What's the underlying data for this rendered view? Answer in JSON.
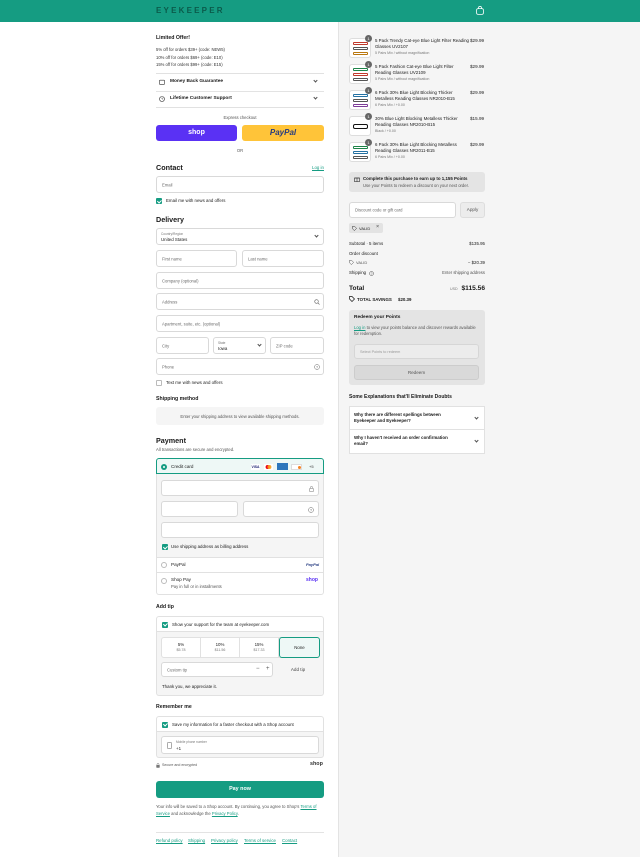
{
  "header": {
    "logo": "EYEKEEPER"
  },
  "offer": {
    "title": "Limited Offer!",
    "lines": [
      "5% off for orders $39+ (code: NEW5)",
      "10% off for orders $69+ (code: E10)",
      "15% off for orders $99+ (code: E15)"
    ],
    "money_back": "Money Back Guarantee",
    "support": "Lifetime Customer Support"
  },
  "express": {
    "label": "Express checkout",
    "shop": "shop",
    "paypal": "PayPal",
    "or": "OR"
  },
  "contact": {
    "title": "Contact",
    "login": "Log in",
    "email_placeholder": "Email",
    "news_label": "Email me with news and offers"
  },
  "delivery": {
    "title": "Delivery",
    "country_label": "Country/Region",
    "country_value": "United States",
    "first_name": "First name",
    "last_name": "Last name",
    "company": "Company (optional)",
    "address": "Address",
    "apartment": "Apartment, suite, etc. (optional)",
    "city": "City",
    "state_label": "State",
    "state_value": "Iowa",
    "zip": "ZIP code",
    "phone": "Phone",
    "text_news": "Text me with news and offers"
  },
  "shipping": {
    "title": "Shipping method",
    "message": "Enter your shipping address to view available shipping methods."
  },
  "payment": {
    "title": "Payment",
    "subtitle": "All transactions are secure and encrypted.",
    "credit_card": "Credit card",
    "card_more": "+5",
    "billing_same": "Use shipping address as billing address",
    "paypal": "PayPal",
    "paypal_logo": "PayPal",
    "shop_pay": "Shop Pay",
    "shop_pay_sub": "Pay in full or in installments",
    "shop_logo": "shop"
  },
  "tip": {
    "title": "Add tip",
    "show_support": "Show your support for the team at eyekeeper.com",
    "options": [
      {
        "pct": "5%",
        "amt": "$5.78"
      },
      {
        "pct": "10%",
        "amt": "$11.56"
      },
      {
        "pct": "15%",
        "amt": "$17.33"
      },
      {
        "pct": "None",
        "amt": ""
      }
    ],
    "custom_placeholder": "Custom tip",
    "add_button": "Add tip",
    "thanks": "Thank you, we appreciate it."
  },
  "remember": {
    "title": "Remember me",
    "save_label": "Save my information for a faster checkout with a Shop account",
    "phone_label": "Mobile phone number",
    "phone_value": "+1",
    "secure": "Secure and encrypted",
    "shop_logo": "shop"
  },
  "pay_button": "Pay now",
  "legal": {
    "text1": "Your info will be saved to a Shop account. By continuing, you agree to Shop's",
    "terms": "Terms of Service",
    "text2": "and acknowledge the",
    "privacy": "Privacy Policy",
    "text3": "."
  },
  "footer": {
    "links": [
      "Refund policy",
      "Shipping",
      "Privacy policy",
      "Terms of service",
      "Contact"
    ]
  },
  "order": {
    "items": [
      {
        "qty": "1",
        "name": "5 Pack Trendy Cat-eye Blue Light Filter Reading Glasses UV2107",
        "sub": "5 Pairs Mix / without magnification",
        "price": "$29.99"
      },
      {
        "qty": "1",
        "name": "5 Pack Fashion Cat-eye Blue Light Filter Reading Glasses UV2109",
        "sub": "5 Pairs Mix / without magnification",
        "price": "$29.99"
      },
      {
        "qty": "1",
        "name": "6 Pack 30% Blue Light Blocking Thicker Metalless Reading Glasses NR2010-B15",
        "sub": "6 Pairs Mix / +0.00",
        "price": "$29.99"
      },
      {
        "qty": "1",
        "name": "30% Blue Light Blocking Metalless Thicker Reading Glasses NR2010-B15",
        "sub": "Black / +0.00",
        "price": "$15.99"
      },
      {
        "qty": "1",
        "name": "6 Pack 30% Blue Light Blocking Metalless Reading Glasses NR2011-B15",
        "sub": "6 Pairs Mix / +0.00",
        "price": "$29.99"
      }
    ],
    "points_title": "Complete this purchase to earn up to 1,155 Points",
    "points_sub": "Use your Points to redeem a discount on your next order.",
    "discount_placeholder": "Discount code or gift card",
    "apply": "Apply",
    "tag": "VALID",
    "subtotal_label": "Subtotal · 5 items",
    "subtotal": "$135.95",
    "order_discount": "Order discount",
    "discount_code": "VALID",
    "discount_amount": "− $20.39",
    "shipping_label": "Shipping",
    "shipping_value": "Enter shipping address",
    "total_label": "Total",
    "currency": "USD",
    "total": "$115.56",
    "savings_label": "TOTAL SAVINGS",
    "savings": "$20.39"
  },
  "redeem": {
    "title": "Redeem your Points",
    "login": "Log in",
    "text": "to view your points balance and discover rewards available for redemption.",
    "select_placeholder": "Select Points to redeem",
    "button": "Redeem"
  },
  "faq": {
    "title": "Some Explanations that'll Eliminate Doubts",
    "items": [
      "Why there are different spellings between Eyekeeper and Eyekeeper?",
      "Why I haven't received an order confirmation email?"
    ]
  },
  "colors": {
    "accent": "#159c82",
    "shop": "#5a31f4",
    "paypal": "#ffc439"
  }
}
